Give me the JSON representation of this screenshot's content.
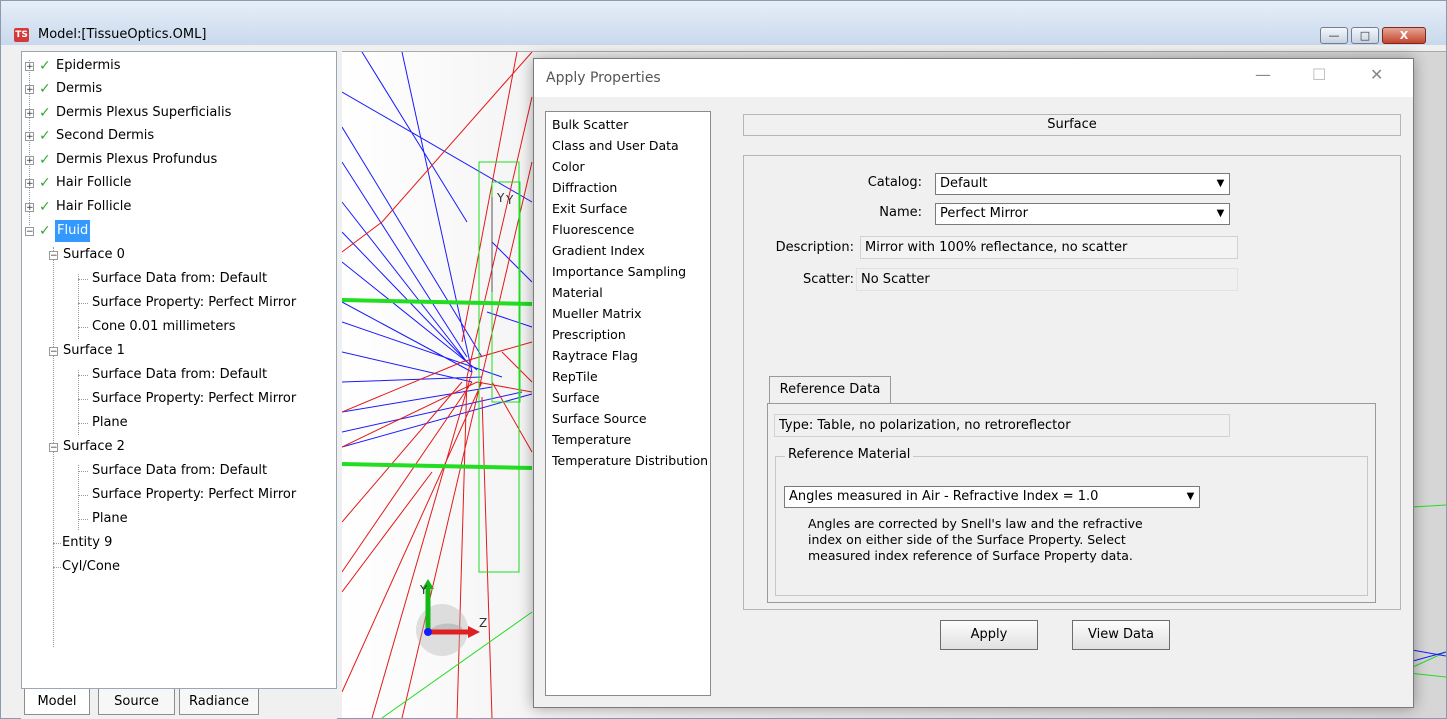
{
  "window": {
    "app_icon": "TS",
    "title": "Model:[TissueOptics.OML]",
    "minimize": "—",
    "maximize": "□",
    "close": "X"
  },
  "tree": {
    "entities": [
      "Epidermis",
      "Dermis",
      "Dermis Plexus Superficialis",
      "Second Dermis",
      "Dermis Plexus Profundus",
      "Hair Follicle",
      "Hair Follicle"
    ],
    "selected": "Fluid",
    "surfaces": [
      {
        "label": "Surface 0",
        "children": [
          "Surface Data from: Default",
          "Surface Property: Perfect Mirror",
          "Cone 0.01 millimeters"
        ]
      },
      {
        "label": "Surface 1",
        "children": [
          "Surface Data from: Default",
          "Surface Property: Perfect Mirror",
          "Plane"
        ]
      },
      {
        "label": "Surface 2",
        "children": [
          "Surface Data from: Default",
          "Surface Property: Perfect Mirror",
          "Plane"
        ]
      }
    ],
    "extra": [
      "Entity 9",
      "Cyl/Cone"
    ]
  },
  "bottom_tabs": [
    "Model",
    "Source",
    "Radiance"
  ],
  "axes": {
    "y": "Y",
    "z": "Z",
    "y2": "Y"
  },
  "dialog": {
    "title": "Apply Properties",
    "min": "—",
    "max": "☐",
    "close": "✕",
    "properties": [
      "Bulk Scatter",
      "Class and User Data",
      "Color",
      "Diffraction",
      "Exit Surface",
      "Fluorescence",
      "Gradient Index",
      "Importance Sampling",
      "Material",
      "Mueller Matrix",
      "Prescription",
      "Raytrace Flag",
      "RepTile",
      "Surface",
      "Surface Source",
      "Temperature",
      "Temperature Distribution"
    ],
    "section": "Surface",
    "catalog_label": "Catalog:",
    "catalog_value": "Default",
    "name_label": "Name:",
    "name_value": "Perfect Mirror",
    "description_label": "Description:",
    "description_value": "Mirror with 100% reflectance, no scatter",
    "scatter_label": "Scatter:",
    "scatter_value": "No Scatter",
    "ref_tab": "Reference Data",
    "type_text": "Type: Table, no polarization, no retroreflector",
    "ref_material_label": "Reference Material",
    "ref_material_value": "Angles measured in Air - Refractive Index = 1.0",
    "note": "Angles are corrected by Snell's law and the refractive index on either side of the Surface Property.  Select measured index reference of Surface Property data.",
    "apply": "Apply",
    "view_data": "View Data"
  }
}
